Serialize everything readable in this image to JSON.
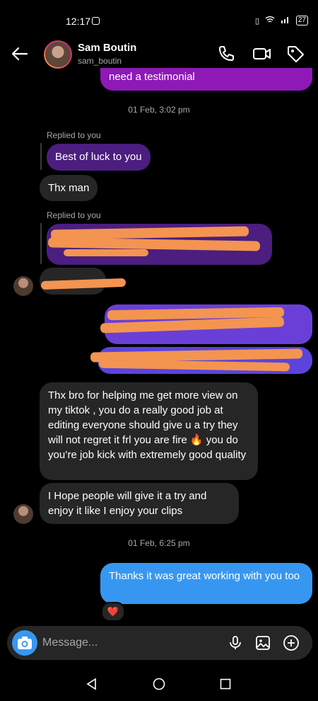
{
  "status": {
    "time": "12:17",
    "battery": "27"
  },
  "header": {
    "name": "Sam Boutin",
    "username": "sam_boutin"
  },
  "messages": {
    "top_partial": "need a testimonial",
    "date1": "01 Feb, 3:02 pm",
    "replied1": "Replied to you",
    "quoted1": "Best of luck to you",
    "reply1": "Thx man",
    "replied2": "Replied to you",
    "long_msg": "Thx bro for helping me get more view on my tiktok , you do a really good job at editing everyone should give u a try they will not regret it frl you are fire 🔥 you do you’re job kick with extremely good  quality",
    "hope_msg": "I Hope people will give it a try and enjoy it like I enjoy your clips",
    "date2": "01 Feb, 6:25 pm",
    "thanks_msg": "Thanks it was great working with you too",
    "reaction": "❤️"
  },
  "composer": {
    "placeholder": "Message..."
  },
  "colors": {
    "outgoing": "#3797f0",
    "incoming": "#262626",
    "accent_purple": "#8e19b6"
  }
}
